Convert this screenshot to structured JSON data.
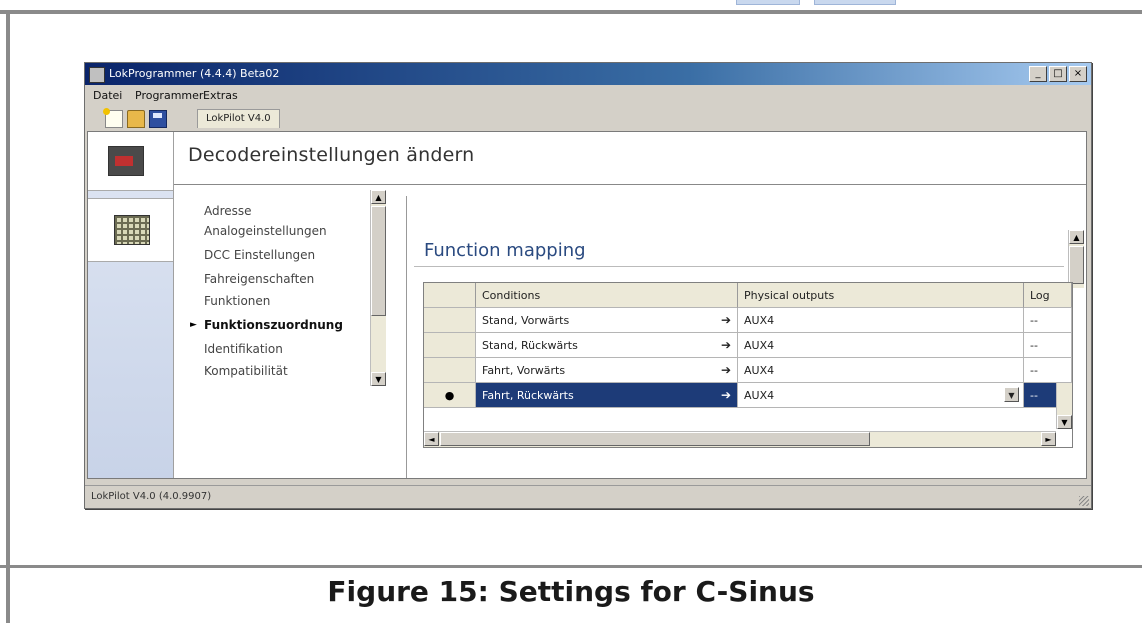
{
  "window": {
    "title": "LokProgrammer (4.4.4) Beta02",
    "controls": [
      "_",
      "□",
      "×"
    ]
  },
  "menu": [
    "Datei",
    "Programmer",
    "Extras"
  ],
  "toolbar": {
    "icons": [
      "new-icon",
      "open-folder-icon",
      "save-disk-icon"
    ],
    "tab_label": "LokPilot V4.0"
  },
  "header": {
    "title": "Decodereinstellungen ändern"
  },
  "nav": {
    "items": [
      "Adresse",
      "Analogeinstellungen",
      "DCC Einstellungen",
      "Fahreigenschaften",
      "Funktionen",
      "Funktionszuordnung",
      "Identifikation",
      "Kompatibilität"
    ],
    "current_index": 5
  },
  "panel": {
    "title": "Function mapping"
  },
  "grid": {
    "columns": [
      "",
      "Conditions",
      "Physical outputs",
      "Log"
    ],
    "rows": [
      {
        "marker": "",
        "condition": "Stand, Vorwärts",
        "arrow": "➔",
        "output": "AUX4",
        "log": "--"
      },
      {
        "marker": "",
        "condition": "Stand, Rückwärts",
        "arrow": "➔",
        "output": "AUX4",
        "log": "--"
      },
      {
        "marker": "",
        "condition": "Fahrt, Vorwärts",
        "arrow": "➔",
        "output": "AUX4",
        "log": "--"
      },
      {
        "marker": "●",
        "condition": "Fahrt, Rückwärts",
        "arrow": "➔",
        "output": "AUX4",
        "log": "--"
      }
    ],
    "selected_row": 3
  },
  "status": {
    "text": "LokPilot V4.0 (4.0.9907)"
  },
  "caption": "Figure 15: Settings for C-Sinus",
  "colors": {
    "titlebar": "#0a246a",
    "selection": "#1d3b78",
    "panel_title": "#2a4a80"
  }
}
